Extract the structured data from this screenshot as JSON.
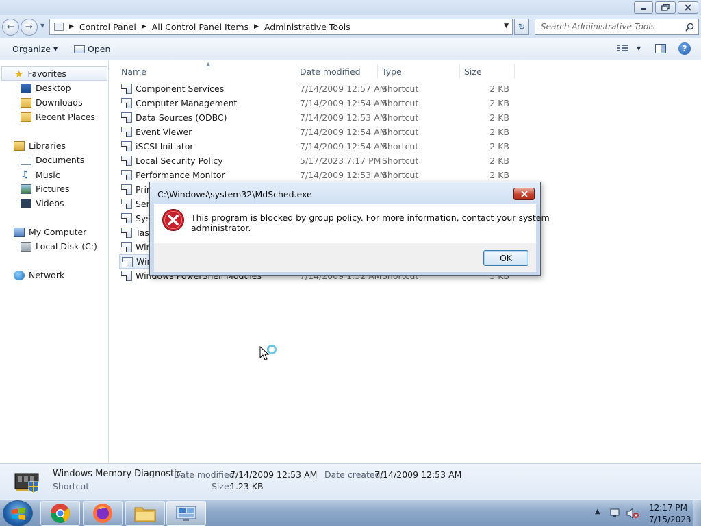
{
  "window": {
    "title_buttons": {
      "minimize_icon": "minimize-icon",
      "restore_icon": "restore-icon",
      "close_icon": "close-icon"
    }
  },
  "address": {
    "crumbs": [
      "Control Panel",
      "All Control Panel Items",
      "Administrative Tools"
    ],
    "search_placeholder": "Search Administrative Tools"
  },
  "toolbar": {
    "organize": "Organize",
    "open": "Open"
  },
  "navigation": {
    "favorites": "Favorites",
    "favorite_items": [
      "Desktop",
      "Downloads",
      "Recent Places"
    ],
    "libraries": "Libraries",
    "library_items": [
      "Documents",
      "Music",
      "Pictures",
      "Videos"
    ],
    "computer": "My Computer",
    "computer_items": [
      "Local Disk (C:)"
    ],
    "network": "Network"
  },
  "columns": {
    "name": "Name",
    "date": "Date modified",
    "type": "Type",
    "size": "Size"
  },
  "files": [
    {
      "name": "Component Services",
      "date": "7/14/2009 12:57 AM",
      "type": "Shortcut",
      "size": "2 KB"
    },
    {
      "name": "Computer Management",
      "date": "7/14/2009 12:54 AM",
      "type": "Shortcut",
      "size": "2 KB"
    },
    {
      "name": "Data Sources (ODBC)",
      "date": "7/14/2009 12:53 AM",
      "type": "Shortcut",
      "size": "2 KB"
    },
    {
      "name": "Event Viewer",
      "date": "7/14/2009 12:54 AM",
      "type": "Shortcut",
      "size": "2 KB"
    },
    {
      "name": "iSCSI Initiator",
      "date": "7/14/2009 12:54 AM",
      "type": "Shortcut",
      "size": "2 KB"
    },
    {
      "name": "Local Security Policy",
      "date": "5/17/2023 7:17 PM",
      "type": "Shortcut",
      "size": "2 KB"
    },
    {
      "name": "Performance Monitor",
      "date": "7/14/2009 12:53 AM",
      "type": "Shortcut",
      "size": "2 KB"
    },
    {
      "name": "Prin",
      "date": "",
      "type": "",
      "size": ""
    },
    {
      "name": "Serv",
      "date": "",
      "type": "",
      "size": ""
    },
    {
      "name": "Syst",
      "date": "",
      "type": "",
      "size": ""
    },
    {
      "name": "Task",
      "date": "",
      "type": "",
      "size": ""
    },
    {
      "name": "Win",
      "date": "",
      "type": "",
      "size": ""
    },
    {
      "name": "Win",
      "date": "",
      "type": "",
      "size": ""
    },
    {
      "name": "Windows PowerShell Modules",
      "date": "7/14/2009 1:32 AM",
      "type": "Shortcut",
      "size": "3 KB"
    }
  ],
  "details": {
    "name": "Windows Memory Diagnostic",
    "kind": "Shortcut",
    "modified_label": "Date modified:",
    "modified_value": "7/14/2009 12:53 AM",
    "created_label": "Date created:",
    "created_value": "7/14/2009 12:53 AM",
    "size_label": "Size:",
    "size_value": "1.23 KB"
  },
  "dialog": {
    "title": "C:\\Windows\\system32\\MdSched.exe",
    "message_line1": "This program is blocked by group policy. For more information, contact your system",
    "message_line2": "administrator.",
    "ok": "OK"
  },
  "taskbar": {
    "time": "12:17 PM",
    "date": "7/15/2023"
  },
  "colors": {
    "accent": "#3c7fb1",
    "error": "#c8202a"
  }
}
